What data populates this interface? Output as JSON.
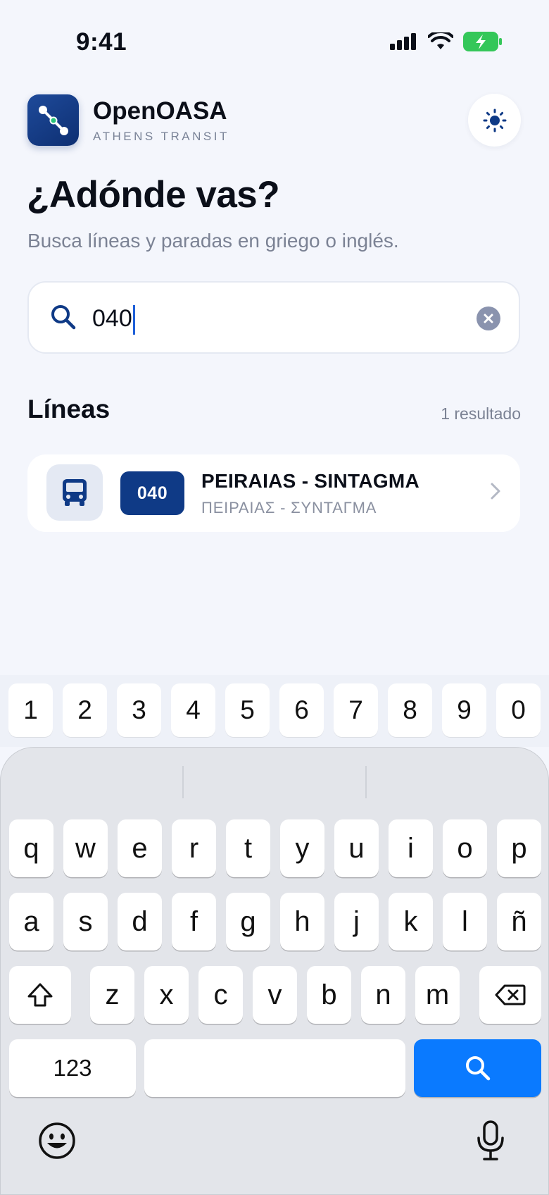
{
  "status": {
    "time": "9:41"
  },
  "header": {
    "app_name": "OpenOASA",
    "app_subtitle": "ATHENS TRANSIT",
    "title": "¿Adónde vas?",
    "subtitle": "Busca líneas y paradas en griego o inglés."
  },
  "search": {
    "value": "040",
    "placeholder": ""
  },
  "results": {
    "section_title": "Líneas",
    "count": "1 resultado",
    "items": [
      {
        "number": "040",
        "name": "PEIRAIAS - SINTAGMA",
        "name_greek": "ΠΕΙΡΑΙΑΣ - ΣΥΝΤΑΓΜΑ"
      }
    ]
  },
  "keyboard": {
    "numbers": [
      "1",
      "2",
      "3",
      "4",
      "5",
      "6",
      "7",
      "8",
      "9",
      "0"
    ],
    "row1": [
      "q",
      "w",
      "e",
      "r",
      "t",
      "y",
      "u",
      "i",
      "o",
      "p"
    ],
    "row2": [
      "a",
      "s",
      "d",
      "f",
      "g",
      "h",
      "j",
      "k",
      "l",
      "ñ"
    ],
    "row3": [
      "z",
      "x",
      "c",
      "v",
      "b",
      "n",
      "m"
    ],
    "mode_key": "123"
  },
  "colors": {
    "accent": "#0f3a86",
    "keyboard_action": "#0a7aff",
    "background": "#f4f6fc"
  }
}
